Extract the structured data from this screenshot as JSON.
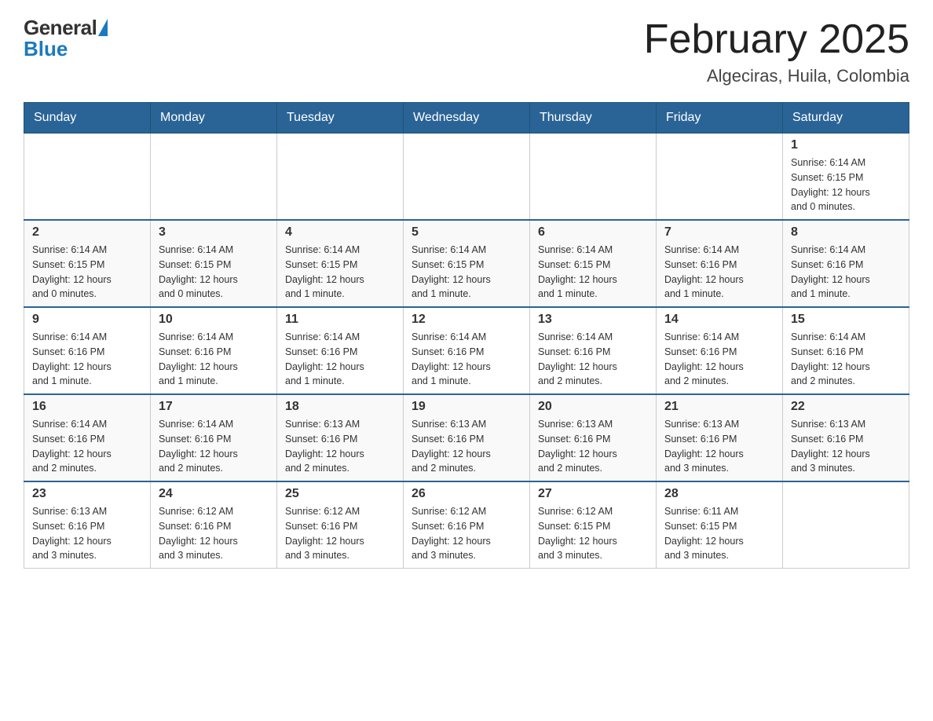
{
  "header": {
    "logo_general": "General",
    "logo_blue": "Blue",
    "month_title": "February 2025",
    "location": "Algeciras, Huila, Colombia"
  },
  "days_of_week": [
    "Sunday",
    "Monday",
    "Tuesday",
    "Wednesday",
    "Thursday",
    "Friday",
    "Saturday"
  ],
  "weeks": [
    [
      {
        "day": "",
        "info": ""
      },
      {
        "day": "",
        "info": ""
      },
      {
        "day": "",
        "info": ""
      },
      {
        "day": "",
        "info": ""
      },
      {
        "day": "",
        "info": ""
      },
      {
        "day": "",
        "info": ""
      },
      {
        "day": "1",
        "info": "Sunrise: 6:14 AM\nSunset: 6:15 PM\nDaylight: 12 hours\nand 0 minutes."
      }
    ],
    [
      {
        "day": "2",
        "info": "Sunrise: 6:14 AM\nSunset: 6:15 PM\nDaylight: 12 hours\nand 0 minutes."
      },
      {
        "day": "3",
        "info": "Sunrise: 6:14 AM\nSunset: 6:15 PM\nDaylight: 12 hours\nand 0 minutes."
      },
      {
        "day": "4",
        "info": "Sunrise: 6:14 AM\nSunset: 6:15 PM\nDaylight: 12 hours\nand 1 minute."
      },
      {
        "day": "5",
        "info": "Sunrise: 6:14 AM\nSunset: 6:15 PM\nDaylight: 12 hours\nand 1 minute."
      },
      {
        "day": "6",
        "info": "Sunrise: 6:14 AM\nSunset: 6:15 PM\nDaylight: 12 hours\nand 1 minute."
      },
      {
        "day": "7",
        "info": "Sunrise: 6:14 AM\nSunset: 6:16 PM\nDaylight: 12 hours\nand 1 minute."
      },
      {
        "day": "8",
        "info": "Sunrise: 6:14 AM\nSunset: 6:16 PM\nDaylight: 12 hours\nand 1 minute."
      }
    ],
    [
      {
        "day": "9",
        "info": "Sunrise: 6:14 AM\nSunset: 6:16 PM\nDaylight: 12 hours\nand 1 minute."
      },
      {
        "day": "10",
        "info": "Sunrise: 6:14 AM\nSunset: 6:16 PM\nDaylight: 12 hours\nand 1 minute."
      },
      {
        "day": "11",
        "info": "Sunrise: 6:14 AM\nSunset: 6:16 PM\nDaylight: 12 hours\nand 1 minute."
      },
      {
        "day": "12",
        "info": "Sunrise: 6:14 AM\nSunset: 6:16 PM\nDaylight: 12 hours\nand 1 minute."
      },
      {
        "day": "13",
        "info": "Sunrise: 6:14 AM\nSunset: 6:16 PM\nDaylight: 12 hours\nand 2 minutes."
      },
      {
        "day": "14",
        "info": "Sunrise: 6:14 AM\nSunset: 6:16 PM\nDaylight: 12 hours\nand 2 minutes."
      },
      {
        "day": "15",
        "info": "Sunrise: 6:14 AM\nSunset: 6:16 PM\nDaylight: 12 hours\nand 2 minutes."
      }
    ],
    [
      {
        "day": "16",
        "info": "Sunrise: 6:14 AM\nSunset: 6:16 PM\nDaylight: 12 hours\nand 2 minutes."
      },
      {
        "day": "17",
        "info": "Sunrise: 6:14 AM\nSunset: 6:16 PM\nDaylight: 12 hours\nand 2 minutes."
      },
      {
        "day": "18",
        "info": "Sunrise: 6:13 AM\nSunset: 6:16 PM\nDaylight: 12 hours\nand 2 minutes."
      },
      {
        "day": "19",
        "info": "Sunrise: 6:13 AM\nSunset: 6:16 PM\nDaylight: 12 hours\nand 2 minutes."
      },
      {
        "day": "20",
        "info": "Sunrise: 6:13 AM\nSunset: 6:16 PM\nDaylight: 12 hours\nand 2 minutes."
      },
      {
        "day": "21",
        "info": "Sunrise: 6:13 AM\nSunset: 6:16 PM\nDaylight: 12 hours\nand 3 minutes."
      },
      {
        "day": "22",
        "info": "Sunrise: 6:13 AM\nSunset: 6:16 PM\nDaylight: 12 hours\nand 3 minutes."
      }
    ],
    [
      {
        "day": "23",
        "info": "Sunrise: 6:13 AM\nSunset: 6:16 PM\nDaylight: 12 hours\nand 3 minutes."
      },
      {
        "day": "24",
        "info": "Sunrise: 6:12 AM\nSunset: 6:16 PM\nDaylight: 12 hours\nand 3 minutes."
      },
      {
        "day": "25",
        "info": "Sunrise: 6:12 AM\nSunset: 6:16 PM\nDaylight: 12 hours\nand 3 minutes."
      },
      {
        "day": "26",
        "info": "Sunrise: 6:12 AM\nSunset: 6:16 PM\nDaylight: 12 hours\nand 3 minutes."
      },
      {
        "day": "27",
        "info": "Sunrise: 6:12 AM\nSunset: 6:15 PM\nDaylight: 12 hours\nand 3 minutes."
      },
      {
        "day": "28",
        "info": "Sunrise: 6:11 AM\nSunset: 6:15 PM\nDaylight: 12 hours\nand 3 minutes."
      },
      {
        "day": "",
        "info": ""
      }
    ]
  ]
}
